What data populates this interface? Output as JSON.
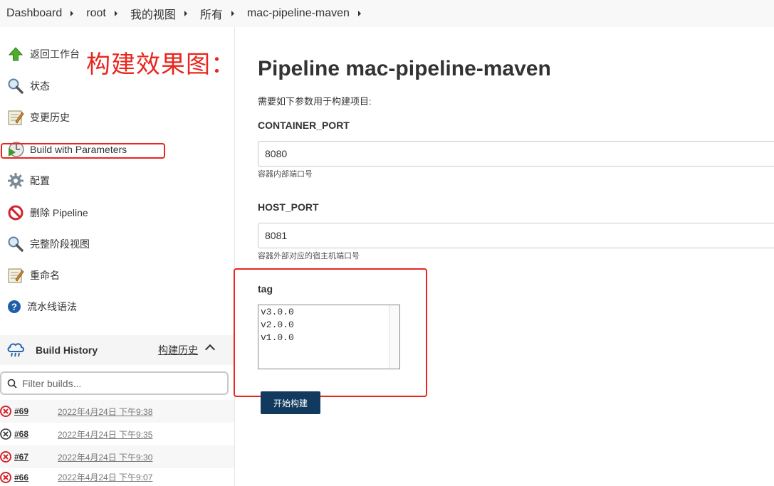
{
  "breadcrumb": [
    "Dashboard",
    "root",
    "我的视图",
    "所有",
    "mac-pipeline-maven"
  ],
  "annotation": "构建效果图：",
  "tasks": [
    {
      "label": "返回工作台",
      "icon": "up-arrow-icon"
    },
    {
      "label": "状态",
      "icon": "magnifier-icon"
    },
    {
      "label": "变更历史",
      "icon": "notepad-icon"
    },
    {
      "label": "Build with Parameters",
      "icon": "build-clock-icon"
    },
    {
      "label": "配置",
      "icon": "gear-icon"
    },
    {
      "label": "删除 Pipeline",
      "icon": "no-entry-icon"
    },
    {
      "label": "完整阶段视图",
      "icon": "magnifier-icon"
    },
    {
      "label": "重命名",
      "icon": "notepad-icon"
    },
    {
      "label": "流水线语法",
      "icon": "help-icon"
    }
  ],
  "build_history": {
    "title": "Build History",
    "trend_label": "构建历史",
    "filter_placeholder": "Filter builds...",
    "builds": [
      {
        "number": "#69",
        "date": "2022年4月24日 下午9:38",
        "status": "failed"
      },
      {
        "number": "#68",
        "date": "2022年4月24日 下午9:35",
        "status": "aborted"
      },
      {
        "number": "#67",
        "date": "2022年4月24日 下午9:30",
        "status": "failed"
      },
      {
        "number": "#66",
        "date": "2022年4月24日 下午9:07",
        "status": "failed"
      }
    ]
  },
  "main": {
    "title": "Pipeline mac-pipeline-maven",
    "description": "需要如下参数用于构建项目:",
    "params": [
      {
        "name": "CONTAINER_PORT",
        "value": "8080",
        "help": "容器内部端口号"
      },
      {
        "name": "HOST_PORT",
        "value": "8081",
        "help": "容器外部对应的宿主机端口号"
      }
    ],
    "tag": {
      "name": "tag",
      "options": [
        "v3.0.0",
        "v2.0.0",
        "v1.0.0"
      ]
    },
    "build_button": "开始构建"
  },
  "colors": {
    "annotation_red": "#e8261d",
    "button_bg": "#123a5f",
    "failed_red": "#d0262b"
  }
}
